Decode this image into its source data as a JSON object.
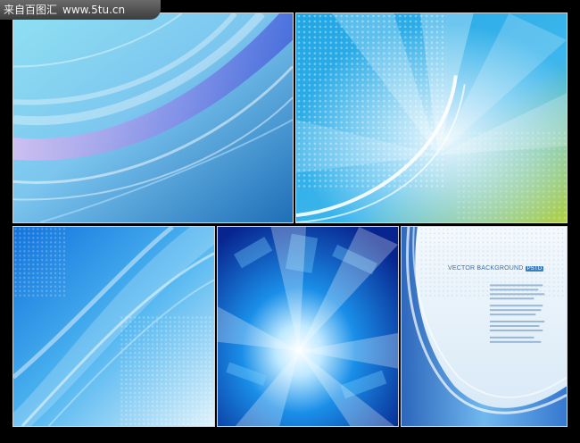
{
  "watermark": {
    "site_name": "来自百图汇",
    "site_url": "www.5tu.cn"
  },
  "panels": [
    {
      "id": "panel-1",
      "palette": [
        "#7fd0f0",
        "#c9a6ee",
        "#2f6fd0"
      ]
    },
    {
      "id": "panel-2",
      "palette": [
        "#1a9fe0",
        "#8fd0f4",
        "#b5d24a"
      ]
    },
    {
      "id": "panel-3",
      "palette": [
        "#0f6fd8",
        "#5ec4f4",
        "#d8f0fb"
      ]
    },
    {
      "id": "panel-4",
      "palette": [
        "#0a2f9a",
        "#1a8fe8",
        "#ffffff"
      ]
    },
    {
      "id": "panel-5",
      "palette": [
        "#e8f2fa",
        "#2a78d0",
        "#0d4fb0"
      ],
      "title": "VECTOR BACKGROUND",
      "badge": "PSTD"
    }
  ]
}
